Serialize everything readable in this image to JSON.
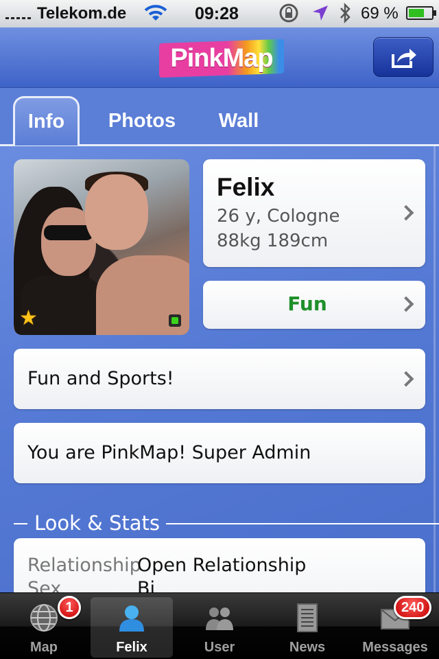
{
  "status_bar": {
    "carrier": "Telekom.de",
    "time": "09:28",
    "battery": "69 %",
    "battery_level": 0.69
  },
  "header": {
    "logo": "PinkMap",
    "share_icon": "share-icon"
  },
  "tabs": [
    {
      "label": "Info",
      "active": true
    },
    {
      "label": "Photos",
      "active": false
    },
    {
      "label": "Wall",
      "active": false
    }
  ],
  "profile": {
    "name": "Felix",
    "age_city": "26 y, Cologne",
    "body": "88kg 189cm",
    "mood": "Fun",
    "status_message": "Fun and Sports!",
    "role": "You are PinkMap! Super Admin",
    "favorite_icon": "star-icon",
    "online_icon": "online-indicator-icon"
  },
  "look_stats": {
    "title": "Look & Stats",
    "rows": [
      {
        "label": "Relationship",
        "value": "Open Relationship"
      },
      {
        "label": "Sex",
        "value": "Bi"
      }
    ]
  },
  "bottom_tabs": [
    {
      "label": "Map",
      "icon": "globe-icon",
      "badge": "1"
    },
    {
      "label": "Felix",
      "icon": "person-icon",
      "active": true
    },
    {
      "label": "User",
      "icon": "users-icon"
    },
    {
      "label": "News",
      "icon": "news-icon"
    },
    {
      "label": "Messages",
      "icon": "envelope-icon",
      "badge": "240"
    }
  ],
  "colors": {
    "accent_blue": "#5b7ed6",
    "mood_green": "#1f8f2a",
    "badge_red": "#d40000"
  }
}
